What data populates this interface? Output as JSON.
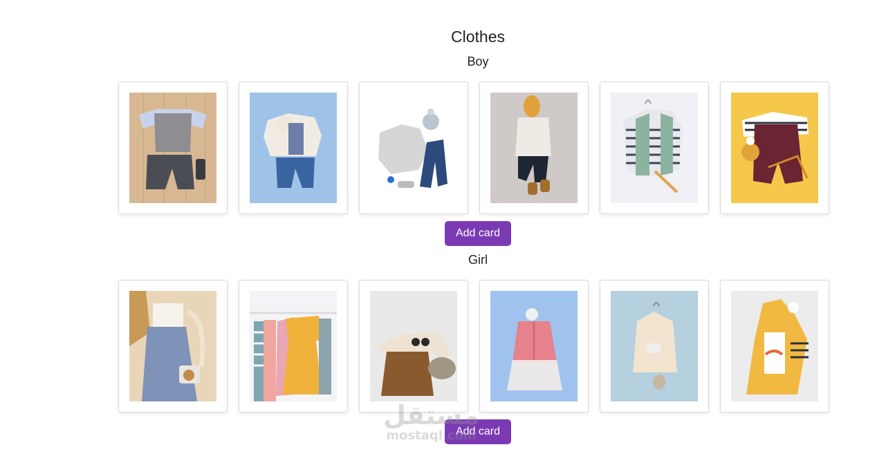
{
  "page": {
    "title": "Clothes"
  },
  "sections": [
    {
      "title": "Boy",
      "add_button_label": "Add card",
      "cards": [
        {
          "bg": "#d8b893",
          "item": "vest-shirt-shorts"
        },
        {
          "bg": "#9fc3e8",
          "item": "cardigan-jeans-bear"
        },
        {
          "bg": "#ffffff",
          "item": "sweater-jeans-hat"
        },
        {
          "bg": "#cfcac8",
          "item": "shirt-pants-hood"
        },
        {
          "bg": "#f0f0f5",
          "item": "striped-vest-hanger"
        },
        {
          "bg": "#f5c84c",
          "item": "overalls-striped-hat"
        }
      ]
    },
    {
      "title": "Girl",
      "add_button_label": "Add card",
      "cards": [
        {
          "bg": "#e9d5b8",
          "item": "denim-overalls-camera"
        },
        {
          "bg": "#f4f4f6",
          "item": "dresses-on-rack"
        },
        {
          "bg": "#e9e9e9",
          "item": "pinafore-knit-hat"
        },
        {
          "bg": "#9fc3ee",
          "item": "pink-jacket-tutu"
        },
        {
          "bg": "#b5d0de",
          "item": "beige-coat-hanger"
        },
        {
          "bg": "#ececec",
          "item": "yellow-jacket-striped"
        }
      ]
    }
  ],
  "watermark": {
    "arabic": "مستقل",
    "latin": "mostaql.com"
  }
}
